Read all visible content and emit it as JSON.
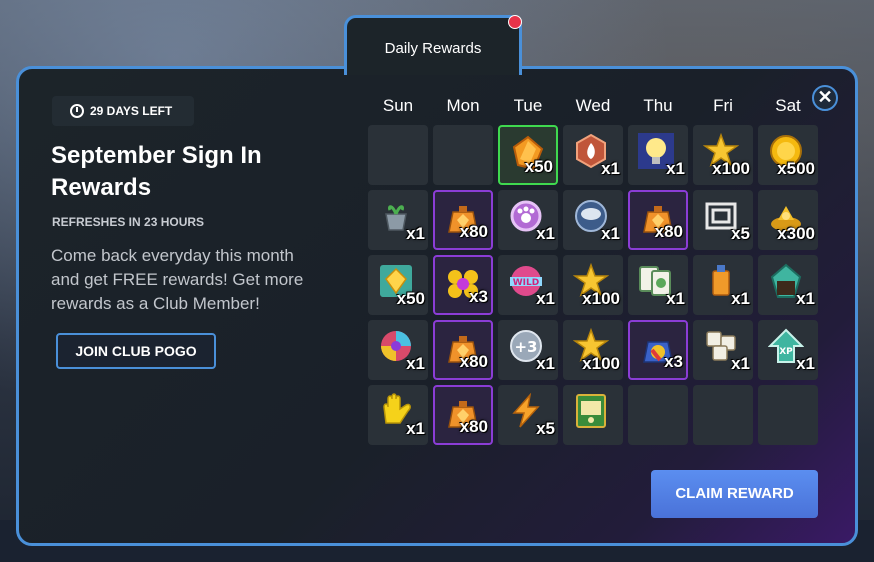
{
  "tab": {
    "label": "Daily Rewards"
  },
  "close": {
    "symbol": "✕"
  },
  "sidebar": {
    "days_left": "29 DAYS LEFT",
    "title": "September Sign In Rewards",
    "refresh": "REFRESHES IN 23 HOURS",
    "description": "Come back everyday this month and get FREE rewards! Get more rewards as a Club Member!",
    "join_label": "JOIN CLUB POGO"
  },
  "days": [
    "Sun",
    "Mon",
    "Tue",
    "Wed",
    "Thu",
    "Fri",
    "Sat"
  ],
  "rewards": [
    {
      "icon": "empty-icon",
      "qty": "",
      "style": "plain"
    },
    {
      "icon": "empty-icon",
      "qty": "",
      "style": "plain"
    },
    {
      "icon": "orange-gem-icon",
      "qty": "x50",
      "style": "green"
    },
    {
      "icon": "fire-gem-icon",
      "qty": "x1",
      "style": "plain"
    },
    {
      "icon": "lightbulb-icon",
      "qty": "x1",
      "style": "plain"
    },
    {
      "icon": "star-icon",
      "qty": "x100",
      "style": "plain"
    },
    {
      "icon": "gold-coin-icon",
      "qty": "x500",
      "style": "plain"
    },
    {
      "icon": "plant-pot-icon",
      "qty": "x1",
      "style": "plain"
    },
    {
      "icon": "gem-bag-icon",
      "qty": "x80",
      "style": "purple"
    },
    {
      "icon": "paw-badge-icon",
      "qty": "x1",
      "style": "plain"
    },
    {
      "icon": "storm-orb-icon",
      "qty": "x1",
      "style": "plain"
    },
    {
      "icon": "gem-bag-icon",
      "qty": "x80",
      "style": "purple"
    },
    {
      "icon": "frame-icon",
      "qty": "x5",
      "style": "plain"
    },
    {
      "icon": "gold-pile-icon",
      "qty": "x300",
      "style": "plain"
    },
    {
      "icon": "gem-card-icon",
      "qty": "x50",
      "style": "plain"
    },
    {
      "icon": "flower-badge-icon",
      "qty": "x3",
      "style": "purple"
    },
    {
      "icon": "wild-card-icon",
      "qty": "x1",
      "style": "plain"
    },
    {
      "icon": "star-icon",
      "qty": "x100",
      "style": "plain"
    },
    {
      "icon": "mahjong-tiles-icon",
      "qty": "x1",
      "style": "plain"
    },
    {
      "icon": "juice-drink-icon",
      "qty": "x1",
      "style": "plain"
    },
    {
      "icon": "teal-gem-icon",
      "qty": "x1",
      "style": "plain"
    },
    {
      "icon": "rainbow-ball-icon",
      "qty": "x1",
      "style": "plain"
    },
    {
      "icon": "gem-bag-icon",
      "qty": "x80",
      "style": "purple"
    },
    {
      "icon": "plus-three-icon",
      "qty": "x1",
      "style": "plain"
    },
    {
      "icon": "star-icon",
      "qty": "x100",
      "style": "plain"
    },
    {
      "icon": "color-bag-icon",
      "qty": "x3",
      "style": "purple"
    },
    {
      "icon": "tile-stack-icon",
      "qty": "x1",
      "style": "plain"
    },
    {
      "icon": "xp-arrow-icon",
      "qty": "x1",
      "style": "plain"
    },
    {
      "icon": "glove-icon",
      "qty": "x1",
      "style": "plain"
    },
    {
      "icon": "gem-bag-icon",
      "qty": "x80",
      "style": "purple"
    },
    {
      "icon": "lightning-icon",
      "qty": "x5",
      "style": "plain"
    },
    {
      "icon": "slot-card-icon",
      "qty": "",
      "style": "plain"
    },
    {
      "icon": "empty-icon",
      "qty": "",
      "style": "plain"
    },
    {
      "icon": "empty-icon",
      "qty": "",
      "style": "plain"
    },
    {
      "icon": "empty-icon",
      "qty": "",
      "style": "plain"
    }
  ],
  "claim_label": "CLAIM REWARD",
  "colors": {
    "accent": "#4a90d9",
    "purple_border": "#8b3dd6",
    "green_border": "#3fd94f",
    "claim": "#5b8ef0"
  }
}
